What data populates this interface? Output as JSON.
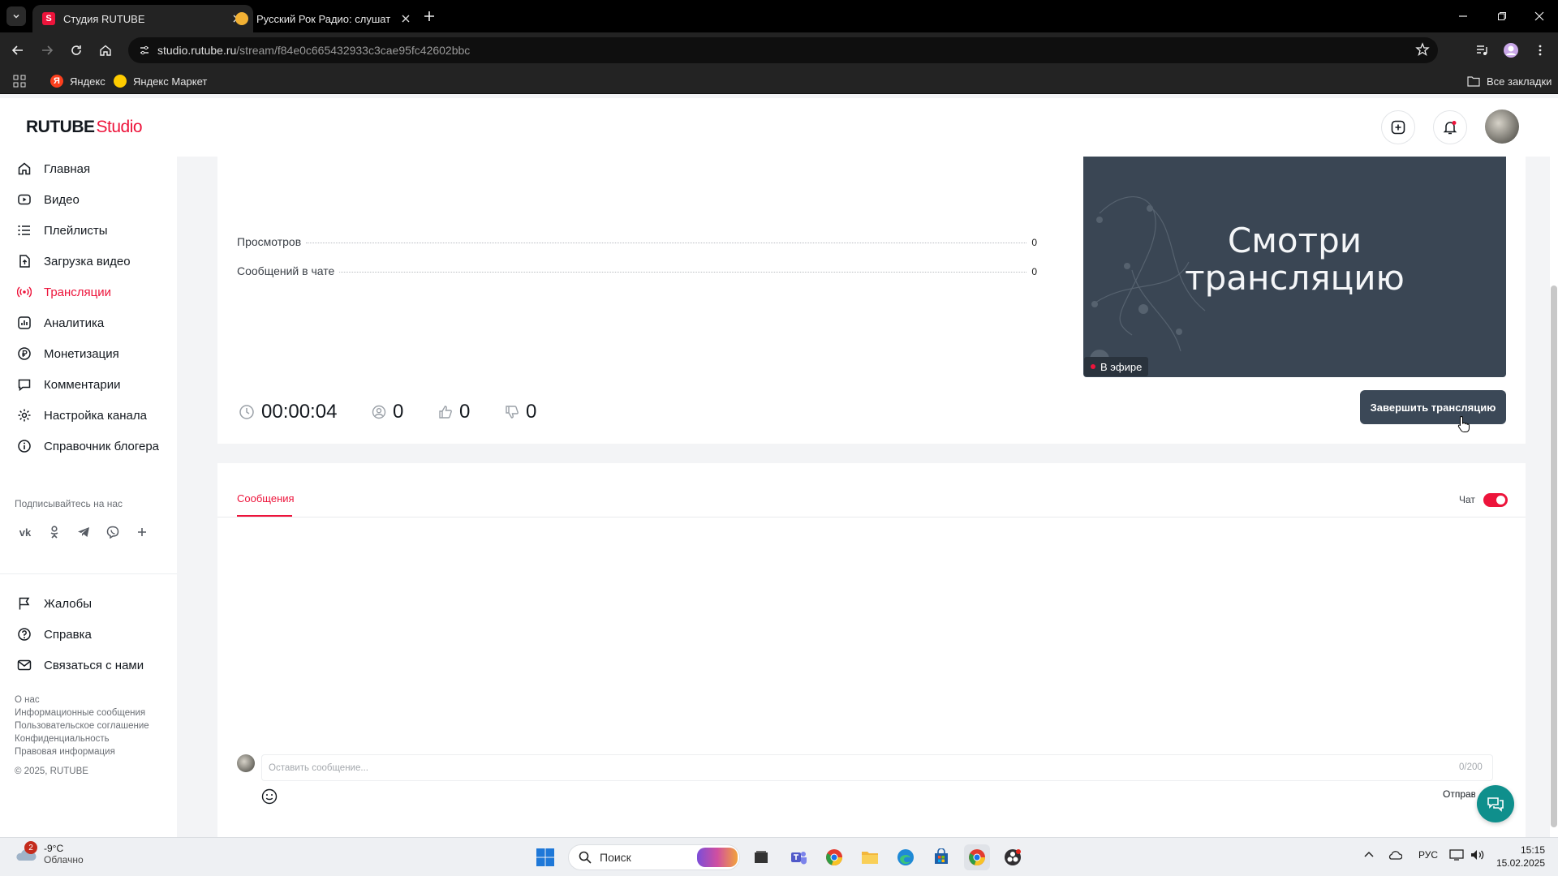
{
  "browser": {
    "tabs": [
      {
        "title": "Студия RUTUBE",
        "active": true
      },
      {
        "title": "Русский Рок Радио: слушать онлайн",
        "active": false
      }
    ],
    "url_host": "studio.rutube.ru",
    "url_path": "/stream/f84e0c665432933c3cae95fc42602bbc",
    "bookmarks": [
      {
        "label": "Яндекс"
      },
      {
        "label": "Яндекс Маркет"
      }
    ],
    "all_bookmarks_label": "Все закладки"
  },
  "logo": {
    "brand": "RUTUBE",
    "product": "Studio"
  },
  "sidebar": {
    "items": [
      {
        "label": "Главная",
        "icon": "home-icon"
      },
      {
        "label": "Видео",
        "icon": "video-icon"
      },
      {
        "label": "Плейлисты",
        "icon": "playlist-icon"
      },
      {
        "label": "Загрузка видео",
        "icon": "upload-icon"
      },
      {
        "label": "Трансляции",
        "icon": "broadcast-icon",
        "active": true
      },
      {
        "label": "Аналитика",
        "icon": "analytics-icon"
      },
      {
        "label": "Монетизация",
        "icon": "ruble-icon"
      },
      {
        "label": "Комментарии",
        "icon": "comments-icon"
      },
      {
        "label": "Настройка канала",
        "icon": "gear-icon"
      },
      {
        "label": "Справочник блогера",
        "icon": "info-icon"
      }
    ],
    "follow_label": "Подписывайтесь на нас",
    "social": [
      "vk-icon",
      "ok-icon",
      "telegram-icon",
      "viber-icon",
      "more-icon"
    ],
    "bottom_items": [
      {
        "label": "Жалобы",
        "icon": "flag-icon"
      },
      {
        "label": "Справка",
        "icon": "help-icon"
      },
      {
        "label": "Связаться с нами",
        "icon": "mail-icon"
      }
    ],
    "footer_links": [
      "О нас",
      "Информационные сообщения",
      "Пользовательское соглашение",
      "Конфиденциальность",
      "Правовая информация"
    ],
    "copyright": "© 2025, RUTUBE"
  },
  "stream": {
    "stats": [
      {
        "label": "Просмотров",
        "value": "0"
      },
      {
        "label": "Сообщений в чате",
        "value": "0"
      }
    ],
    "preview_text_line1": "Смотри",
    "preview_text_line2": "трансляцию",
    "live_badge": "В эфире",
    "duration": "00:00:04",
    "viewers": "0",
    "likes": "0",
    "dislikes": "0",
    "end_button": "Завершить трансляцию"
  },
  "chat": {
    "tab_label": "Сообщения",
    "toggle_label": "Чат",
    "toggle_on": true,
    "input_placeholder": "Оставить сообщение...",
    "char_count": "0/200",
    "send_label": "Отправить"
  },
  "taskbar": {
    "weather_temp": "-9°C",
    "weather_cond": "Облачно",
    "weather_badge": "2",
    "search_placeholder": "Поиск",
    "language": "РУС",
    "time": "15:15",
    "date": "15.02.2025"
  },
  "colors": {
    "accent": "#ed143b",
    "button_dark": "#3b4857",
    "preview_bg": "#3a4654"
  }
}
